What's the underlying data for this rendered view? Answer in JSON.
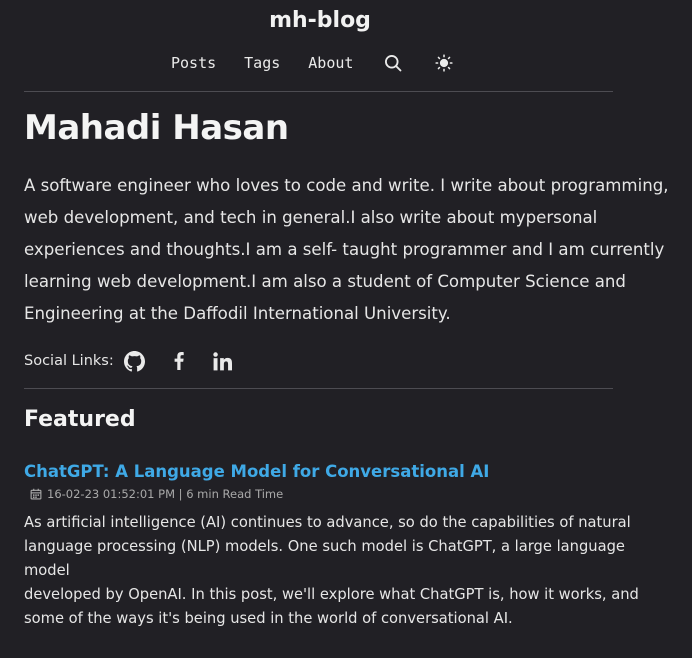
{
  "site": {
    "title": "mh-blog"
  },
  "nav": {
    "items": [
      {
        "label": "Posts"
      },
      {
        "label": "Tags"
      },
      {
        "label": "About"
      }
    ],
    "search_icon": "search-icon",
    "theme_icon": "sun-icon"
  },
  "profile": {
    "name": "Mahadi Hasan",
    "bio_lines": [
      "A software engineer who loves to code and write. I write about programming,",
      "web development, and tech in general.I also write about mypersonal",
      "experiences and thoughts.I am a self- taught programmer and I am currently",
      "learning web development.I am also a student of Computer Science and",
      "Engineering at the Daffodil International University."
    ],
    "social_label": "Social Links:",
    "social_icons": [
      "github-icon",
      "facebook-icon",
      "linkedin-icon"
    ]
  },
  "featured": {
    "heading": "Featured",
    "posts": [
      {
        "title": "ChatGPT: A Language Model for Conversational AI",
        "meta": "16-02-23 01:52:01 PM | 6 min Read Time",
        "excerpt_lines": [
          "As artificial intelligence (AI) continues to advance, so do the capabilities of natural",
          "language processing (NLP) models. One such model is ChatGPT, a large language model",
          "developed by OpenAI. In this post, we'll explore what ChatGPT is, how it works, and",
          "some of the ways it's being used in the world of conversational AI."
        ]
      }
    ]
  },
  "colors": {
    "background": "#212025",
    "link_accent": "#3fa9e6",
    "divider": "#4d4c52"
  }
}
